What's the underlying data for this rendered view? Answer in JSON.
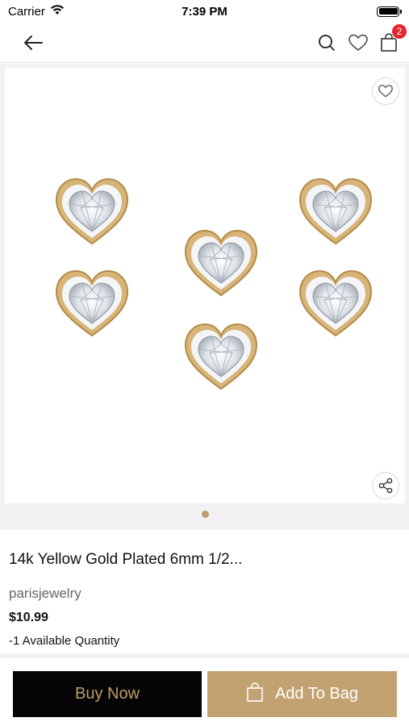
{
  "status_bar": {
    "carrier": "Carrier",
    "time": "7:39 PM"
  },
  "nav": {
    "back_icon": "arrow-left-icon",
    "search_icon": "search-icon",
    "wishlist_icon": "heart-icon",
    "cart_icon": "bag-icon",
    "cart_count": "2"
  },
  "gallery": {
    "image_description_icon": "heart-stud-earrings",
    "page_count": 1,
    "active_index": 0
  },
  "product": {
    "title": "14k Yellow Gold Plated 6mm 1/2...",
    "vendor": "parisjewelry",
    "price": "$10.99",
    "quantity_text": "-1 Available Quantity"
  },
  "actions": {
    "buy_now_label": "Buy Now",
    "add_to_bag_label": "Add To Bag"
  },
  "colors": {
    "accent_gold": "#c3a272",
    "buy_now_bg": "#050505",
    "badge_red": "#e5282f"
  }
}
